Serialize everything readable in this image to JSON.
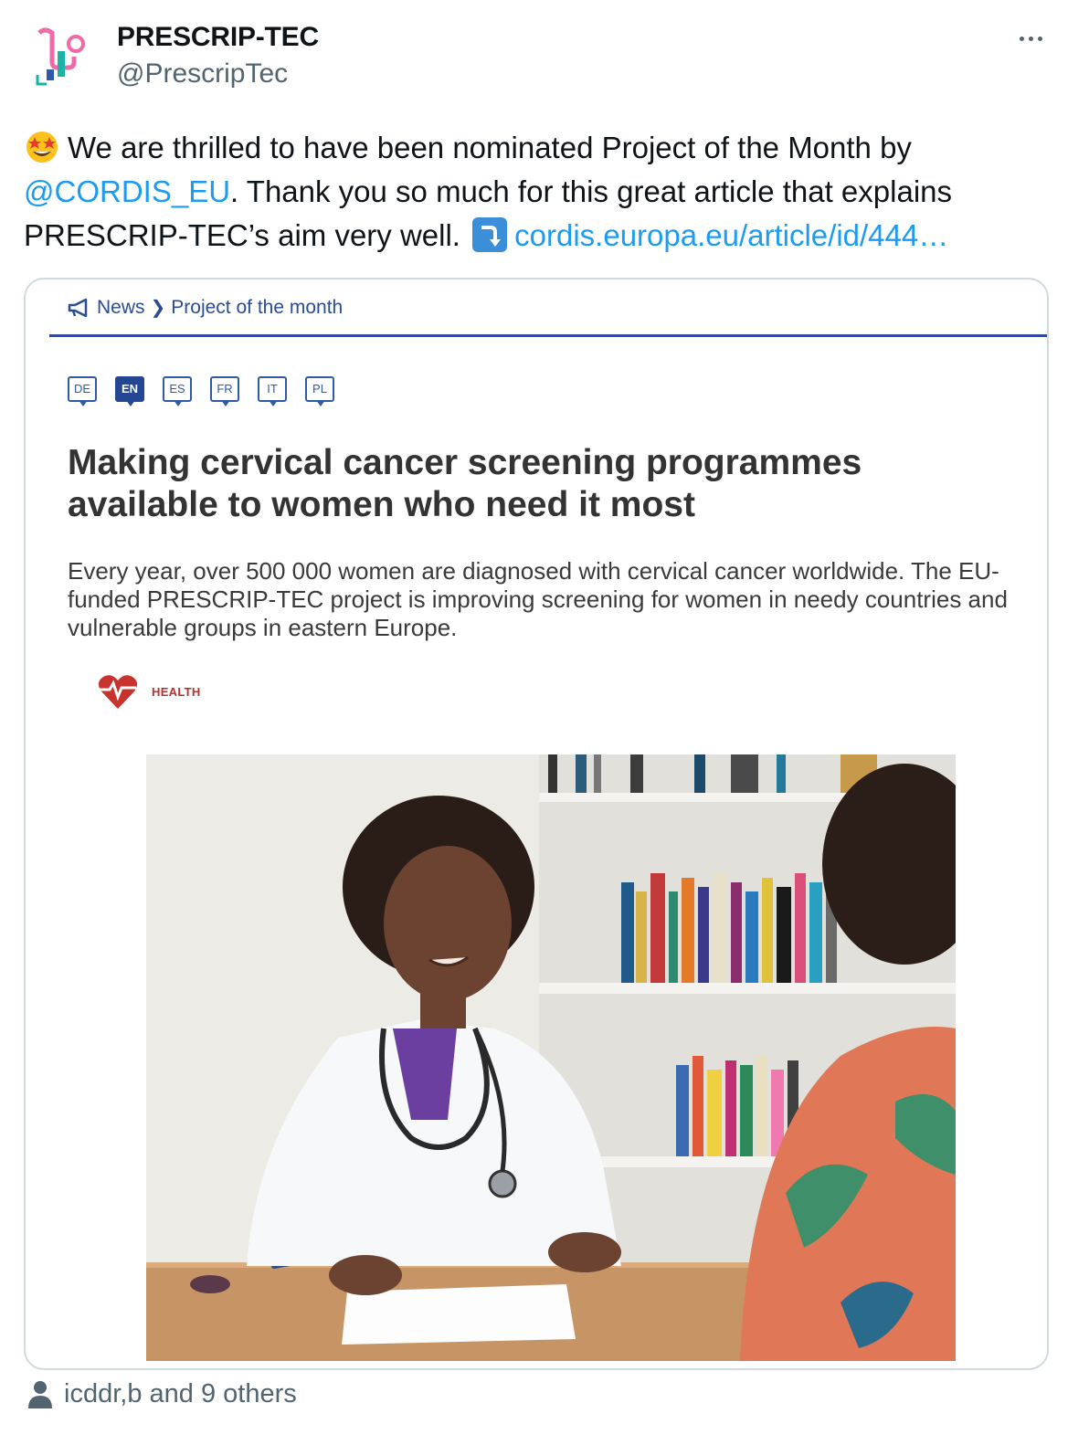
{
  "author": {
    "display_name": "PRESCRIP-TEC",
    "handle": "@PrescripTec",
    "avatar_icon": "prescrip-tec-logo"
  },
  "tweet": {
    "emoji_start": "star-struck-emoji",
    "text_part1": "We are thrilled to have been nominated Project of the Month by ",
    "mention": "@CORDIS_EU",
    "text_part2": ". Thank you so much for this great article that explains PRESCRIP-TEC’s aim very well.",
    "emoji_arrow": "right-arrow-curving-down-emoji",
    "link_text": "cordis.europa.eu/article/id/444…"
  },
  "card": {
    "breadcrumb": {
      "news": "News",
      "section": "Project of the month"
    },
    "languages": [
      "DE",
      "EN",
      "ES",
      "FR",
      "IT",
      "PL"
    ],
    "active_language": "EN",
    "title": "Making cervical cancer screening programmes available to women who need it most",
    "subtitle": "Every year, over 500 000 women are diagnosed with cervical cancer worldwide. The EU-funded PRESCRIP-TEC project is improving screening for women in needy countries and vulnerable groups in eastern Europe.",
    "category": "HEALTH"
  },
  "footer": {
    "tagged_text": "icddr,b and 9 others"
  },
  "colors": {
    "link": "#1d9bf0",
    "secondary_text": "#536471",
    "cordis_blue": "#2f4aa0",
    "health_red": "#b8302b"
  }
}
